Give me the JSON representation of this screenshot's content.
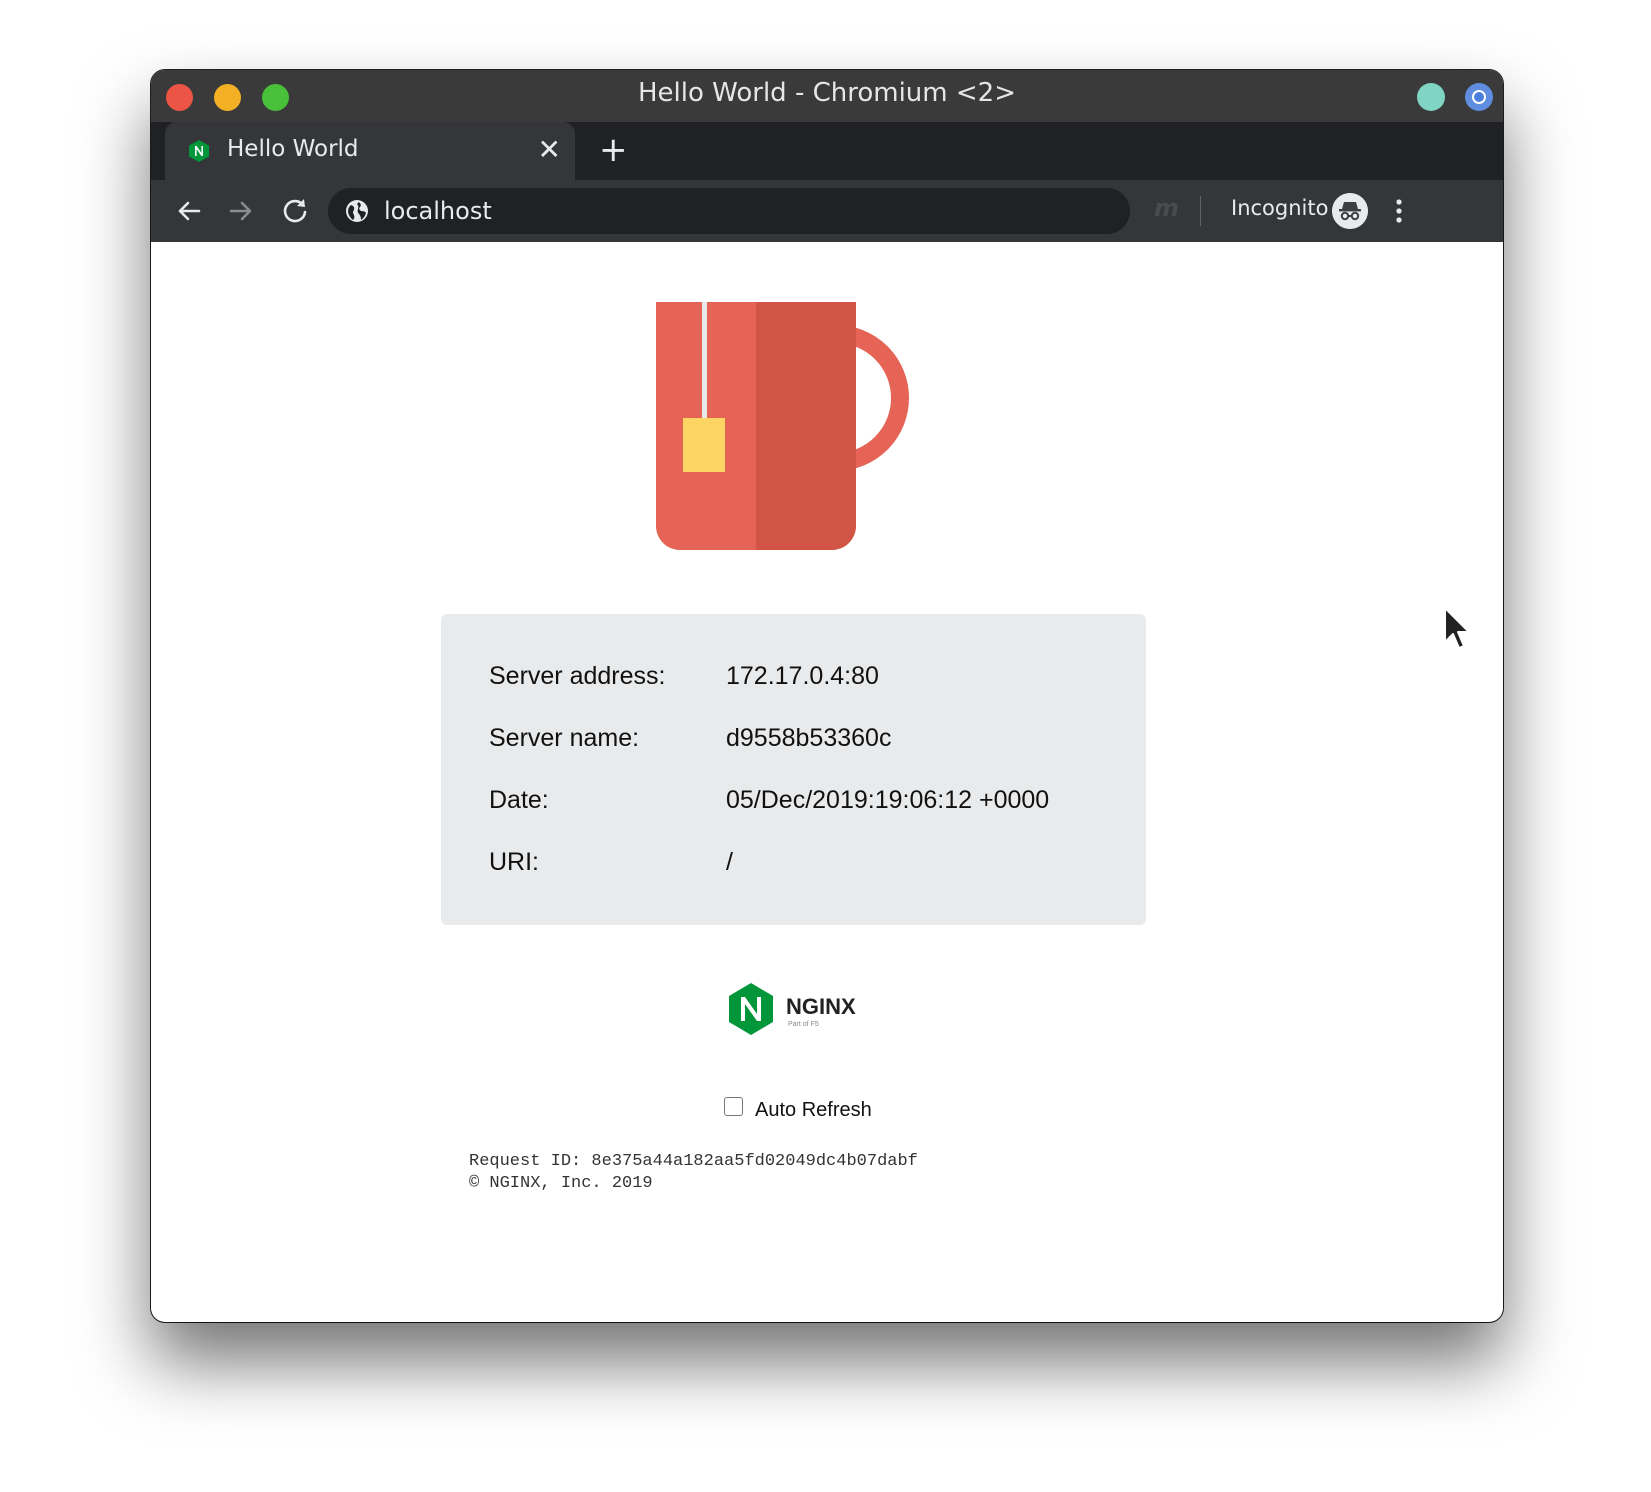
{
  "window": {
    "title": "Hello World - Chromium <2>"
  },
  "tab": {
    "title": "Hello World",
    "close_glyph": "✕",
    "new_tab_glyph": "+"
  },
  "toolbar": {
    "url": "localhost",
    "extension_glyph": "m",
    "incognito_label": "Incognito"
  },
  "info": {
    "rows": [
      {
        "label": "Server address:",
        "value": "172.17.0.4:80"
      },
      {
        "label": "Server name:",
        "value": "d9558b53360c"
      },
      {
        "label": "Date:",
        "value": "05/Dec/2019:19:06:12 +0000"
      },
      {
        "label": "URI:",
        "value": "/"
      }
    ]
  },
  "logo": {
    "wordmark": "NGINX",
    "tagline": "Part of F5"
  },
  "auto_refresh": {
    "label": "Auto Refresh",
    "checked": false
  },
  "footer": {
    "request_id": "Request ID: 8e375a44a182aa5fd02049dc4b07dabf",
    "copyright": "© NGINX, Inc. 2019"
  },
  "colors": {
    "mug_left": "#e56455",
    "mug_right": "#d25444",
    "tea_tag": "#fdd562",
    "nginx_green": "#009639",
    "info_bg": "#e9eaeb",
    "titlebar": "#3a3a3a",
    "toolbar": "#35363a"
  }
}
